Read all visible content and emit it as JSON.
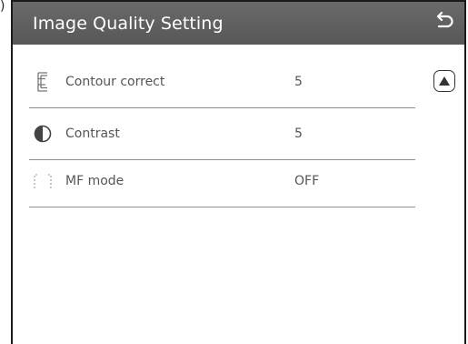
{
  "corner_mark": ")",
  "header": {
    "title": "Image Quality Setting",
    "back_icon": "return-arrow-icon"
  },
  "settings": [
    {
      "label": "Contour correct",
      "value": "5",
      "icon": "contour-correct-icon"
    },
    {
      "label": "Contrast",
      "value": "5",
      "icon": "contrast-icon"
    },
    {
      "label": "MF mode",
      "value": "OFF",
      "icon": "mf-mode-bracket-icon"
    }
  ],
  "scroll": {
    "icon": "scroll-up-triangle-icon"
  },
  "colors": {
    "title_bar": "#5f5f5f",
    "title_text": "#ffffff",
    "label_text": "#555555",
    "divider": "#8f8f8f"
  }
}
